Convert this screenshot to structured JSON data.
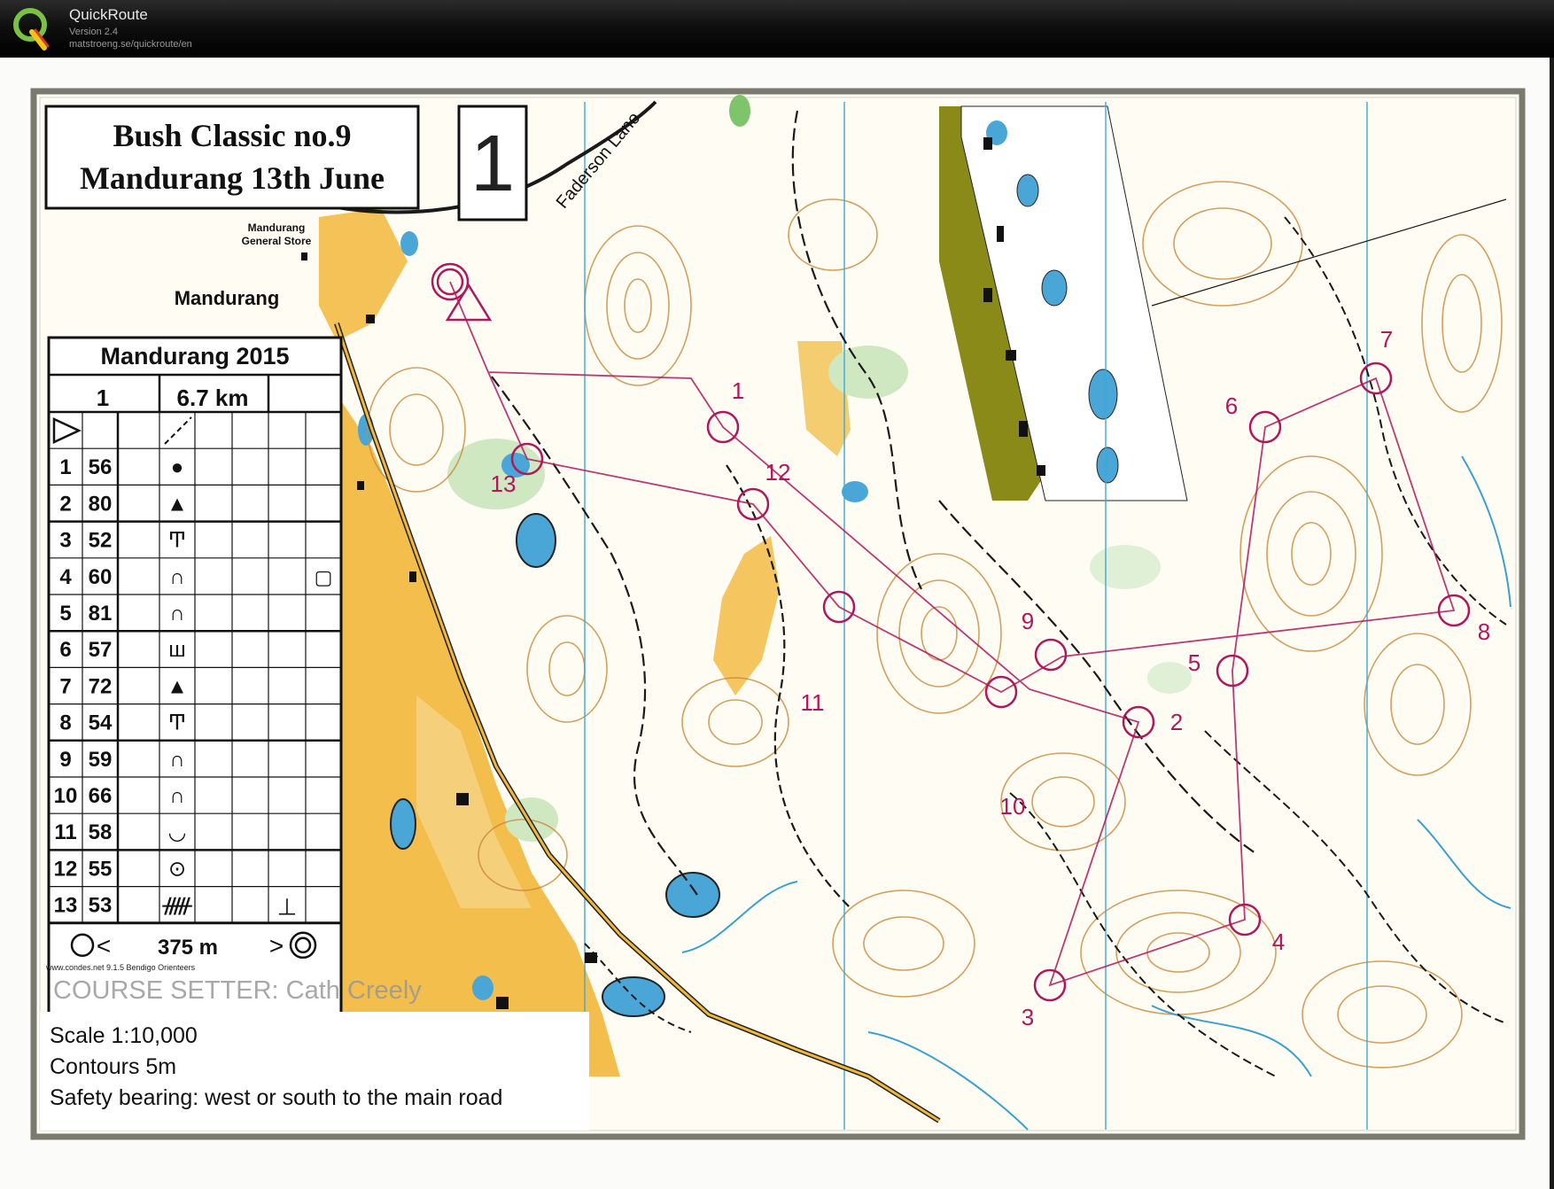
{
  "app": {
    "name": "QuickRoute",
    "version": "Version 2.4",
    "url": "matstroeng.se/quickroute/en"
  },
  "map": {
    "title_line1": "Bush Classic no.9",
    "title_line2": "Mandurang 13th June",
    "course_number": "1",
    "road_name": "Faderson Lane",
    "store_label_line1": "Mandurang",
    "store_label_line2": "General Store",
    "town_label": "Mandurang",
    "course_setter": "COURSE SETTER: Cath Creely",
    "credit": "www.condes.net 9.1.5 Bendigo Orienteers",
    "notes": {
      "scale": "Scale 1:10,000",
      "contours": "Contours 5m",
      "safety": "Safety bearing: west or south to the main road"
    },
    "control_description": {
      "event": "Mandurang 2015",
      "course": "1",
      "length": "6.7 km",
      "rows": [
        {
          "num": "1",
          "code": "56",
          "symbol": "●"
        },
        {
          "num": "2",
          "code": "80",
          "symbol": "▲"
        },
        {
          "num": "3",
          "code": "52",
          "symbol": "Ͳ"
        },
        {
          "num": "4",
          "code": "60",
          "symbol": "∩"
        },
        {
          "num": "5",
          "code": "81",
          "symbol": "∩"
        },
        {
          "num": "6",
          "code": "57",
          "symbol": "ш"
        },
        {
          "num": "7",
          "code": "72",
          "symbol": "▲"
        },
        {
          "num": "8",
          "code": "54",
          "symbol": "Ͳ"
        },
        {
          "num": "9",
          "code": "59",
          "symbol": "∩"
        },
        {
          "num": "10",
          "code": "66",
          "symbol": "∩"
        },
        {
          "num": "11",
          "code": "58",
          "symbol": "◡"
        },
        {
          "num": "12",
          "code": "55",
          "symbol": "⊙"
        },
        {
          "num": "13",
          "code": "53",
          "symbol": "ᚏ"
        }
      ],
      "finish_distance": "375 m"
    },
    "controls": [
      {
        "label": "1"
      },
      {
        "label": "2"
      },
      {
        "label": "3"
      },
      {
        "label": "4"
      },
      {
        "label": "5"
      },
      {
        "label": "6"
      },
      {
        "label": "7"
      },
      {
        "label": "8"
      },
      {
        "label": "9"
      },
      {
        "label": "10"
      },
      {
        "label": "11"
      },
      {
        "label": "12"
      },
      {
        "label": "13"
      }
    ],
    "colors": {
      "course": "#b0185c",
      "contour": "#c98a3a",
      "yellow": "#f2b73a",
      "water": "#4aa6d6",
      "grid": "#3aa9d8",
      "track": "#1a1a1a"
    }
  }
}
